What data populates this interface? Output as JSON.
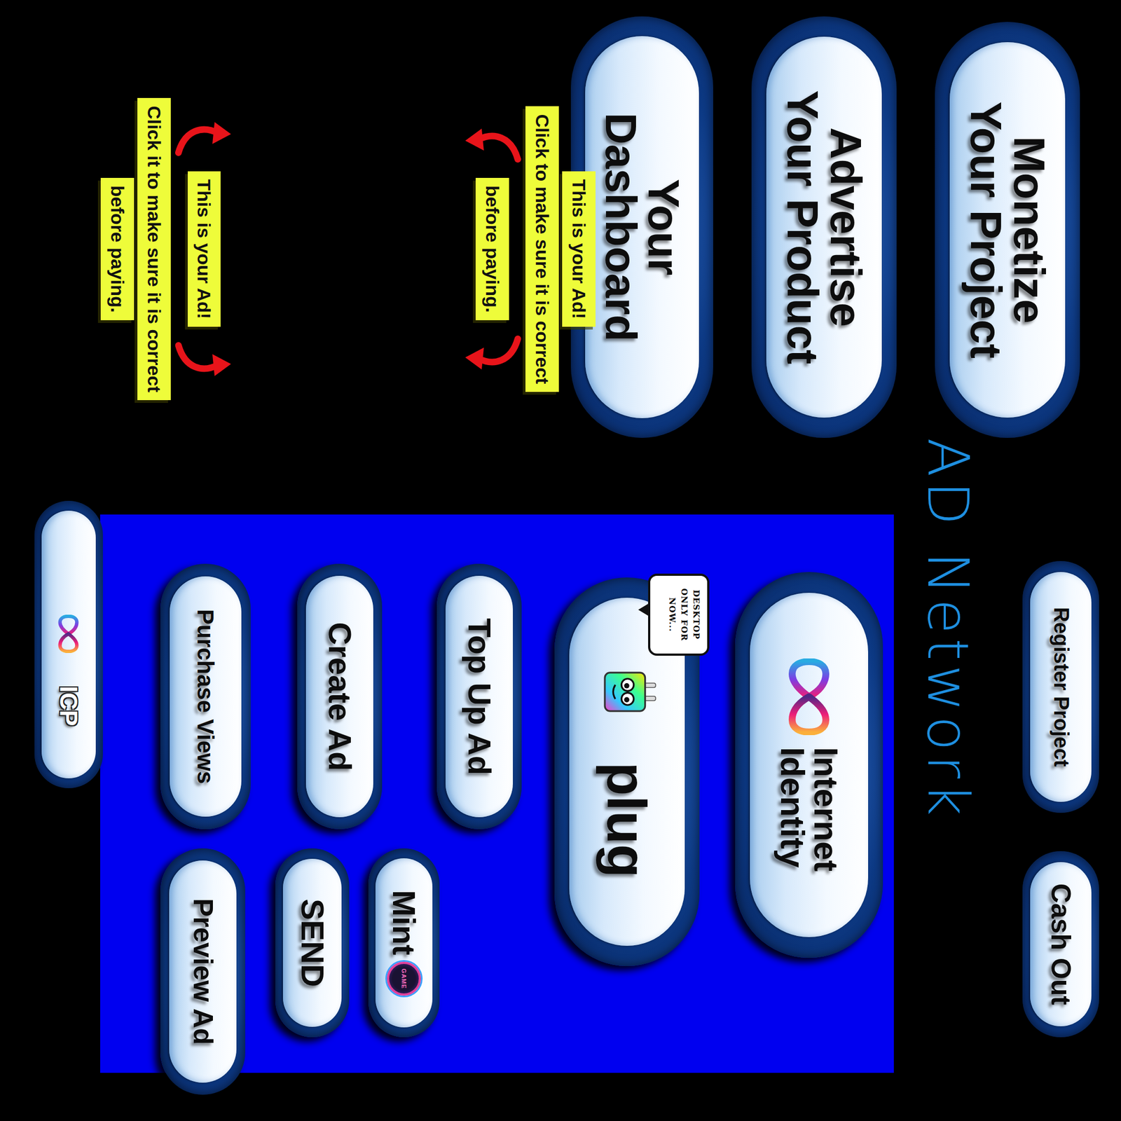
{
  "title": "AD Network",
  "main_buttons": [
    {
      "lines": [
        "Monetize",
        "Your Project"
      ]
    },
    {
      "lines": [
        "Advertise",
        "Your Product"
      ]
    },
    {
      "lines": [
        "Your",
        "Dashboard"
      ]
    }
  ],
  "buttons": [
    {
      "lines": [
        "Register Project"
      ],
      "kind": "text"
    },
    {
      "lines": [
        "Cash Out"
      ],
      "kind": "text"
    },
    {
      "lines": [
        "Internet",
        "Identity"
      ],
      "kind": "ii"
    },
    {
      "lines": [
        "plug"
      ],
      "kind": "plug",
      "note": "DESKTOP ONLY FOR NOW..."
    },
    {
      "lines": [
        "Top Up Ad"
      ],
      "kind": "text"
    },
    {
      "lines": [
        "Mint"
      ],
      "kind": "mint",
      "badge": "GAME"
    },
    {
      "lines": [
        "Create Ad"
      ],
      "kind": "text"
    },
    {
      "lines": [
        "SEND"
      ],
      "kind": "text"
    },
    {
      "lines": [
        "Purchase Views"
      ],
      "kind": "text"
    },
    {
      "lines": [
        "Preview Ad"
      ],
      "kind": "text"
    },
    {
      "lines": [
        "ICP"
      ],
      "kind": "icp"
    }
  ],
  "callouts": [
    {
      "lines": [
        "This is your Ad!",
        "Click to make sure it is correct",
        "before paying."
      ]
    },
    {
      "lines": [
        "This is your Ad!",
        "Click it to make sure it is correct",
        "before paying."
      ]
    }
  ]
}
